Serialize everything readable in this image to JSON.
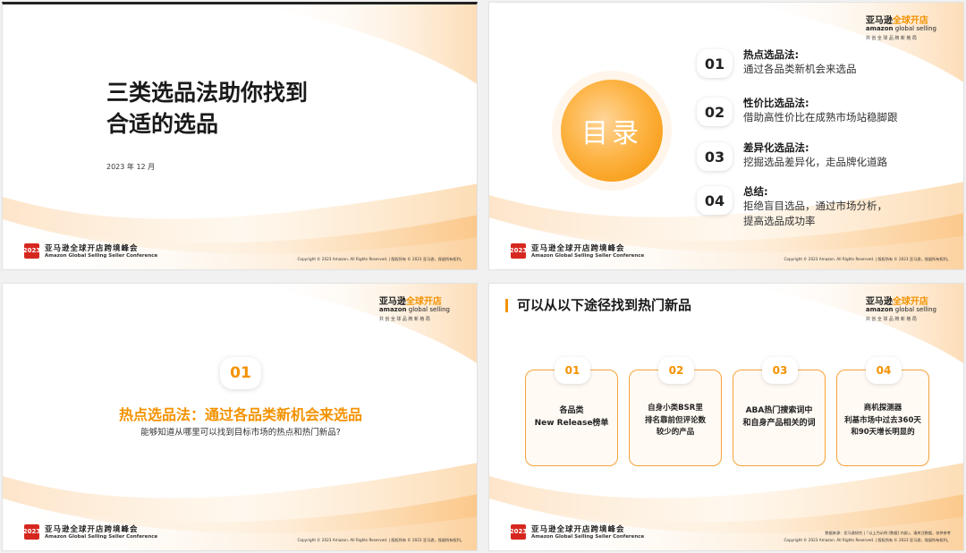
{
  "footer": {
    "seal_text": "2023",
    "cn": "亚马逊全球开店跨境峰会",
    "en": "Amazon Global Selling Seller Conference",
    "copyright": "Copyright © 2023 Amazon. All Rights Reserved. | 版权所有 © 2023 亚马逊，保留所有权利。"
  },
  "brand": {
    "part1": "亚马逊",
    "part2": "全球开店",
    "line2_a": "amazon",
    "line2_b": " global selling",
    "tagline": "共创全球品牌新格局"
  },
  "colors": {
    "accent": "#f39200",
    "seal": "#d6271f"
  },
  "slide1": {
    "title_line1": "三类选品法助你找到",
    "title_line2": "合适的选品",
    "date": "2023 年 12 月"
  },
  "slide2": {
    "circle_label": "目录",
    "items": [
      {
        "num": "01",
        "heading": "热点选品法:",
        "desc": "通过各品类新机会来选品"
      },
      {
        "num": "02",
        "heading": "性价比选品法:",
        "desc": "借助高性价比在成熟市场站稳脚跟"
      },
      {
        "num": "03",
        "heading": "差异化选品法:",
        "desc": "挖掘选品差异化，走品牌化道路"
      },
      {
        "num": "04",
        "heading": "总结:",
        "desc": "拒绝盲目选品，通过市场分析，",
        "desc2": "提高选品成功率"
      }
    ]
  },
  "slide3": {
    "num": "01",
    "title": "热点选品法：通过各品类新机会来选品",
    "subtitle": "能够知道从哪里可以找到目标市场的热点和热门新品?"
  },
  "slide4": {
    "title": "可以从以下途径找到热门新品",
    "cards": [
      {
        "num": "01",
        "text": "各品类\nNew Release榜单"
      },
      {
        "num": "02",
        "text": "自身小类BSR里\n排名靠前但评论数\n较少的产品"
      },
      {
        "num": "03",
        "text": "ABA热门搜索词中\n和自身产品相关的词"
      },
      {
        "num": "04",
        "text": "商机探测器\n利基市场中过去360天\n和90天增长明显的"
      }
    ],
    "source": "数据来源：亚马逊研究 |「以上为示例 [数据] 内部」，请关注数据，仅供参考"
  }
}
